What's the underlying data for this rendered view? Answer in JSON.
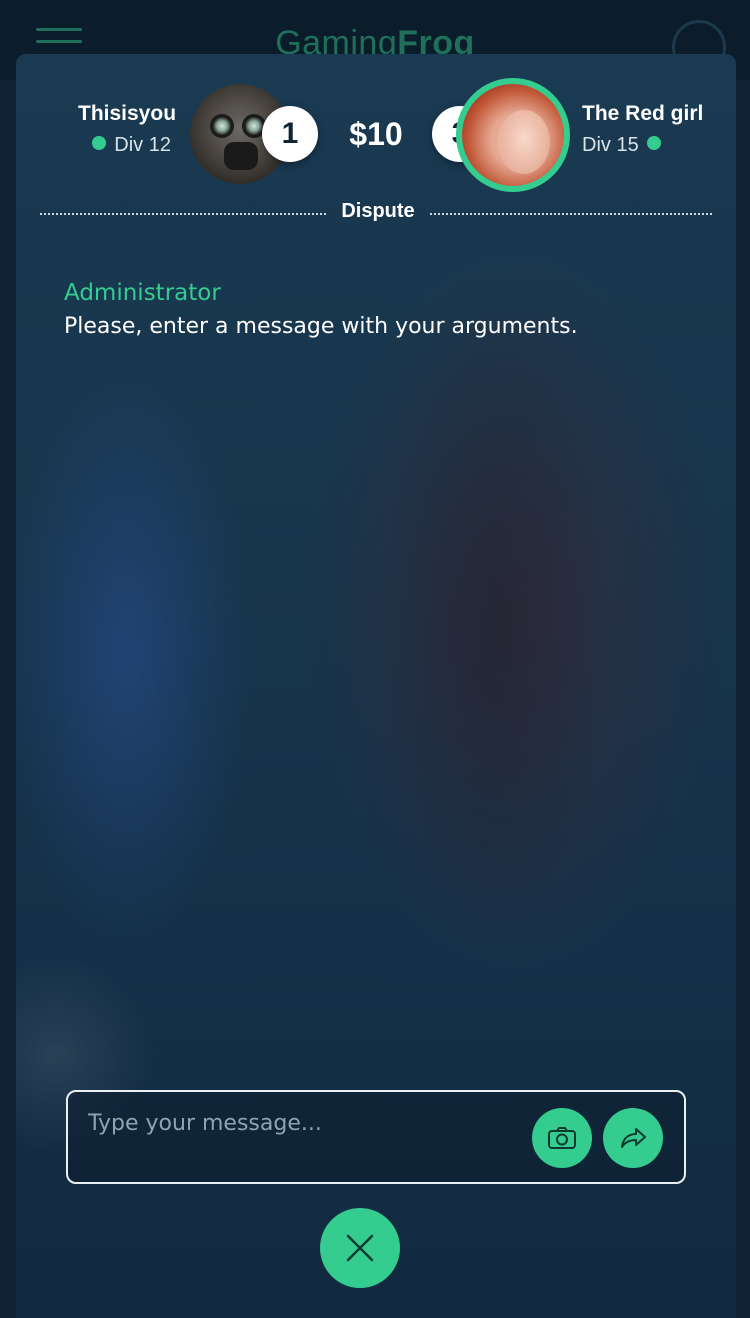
{
  "app": {
    "logo_light": "Gaming",
    "logo_bold": "Frog"
  },
  "match": {
    "stake": "$10",
    "status_label": "Dispute",
    "player_left": {
      "name": "Thisisyou",
      "division": "Div 12",
      "rank": "1"
    },
    "player_right": {
      "name": "The Red girl",
      "division": "Div 15",
      "rank": "3"
    }
  },
  "chat": {
    "messages": [
      {
        "author": "Administrator",
        "text": "Please, enter a message with your arguments."
      }
    ]
  },
  "composer": {
    "placeholder": "Type your message..."
  },
  "colors": {
    "accent": "#35cc90",
    "modal_bg": "#17354b",
    "page_bg": "#0e2233"
  }
}
